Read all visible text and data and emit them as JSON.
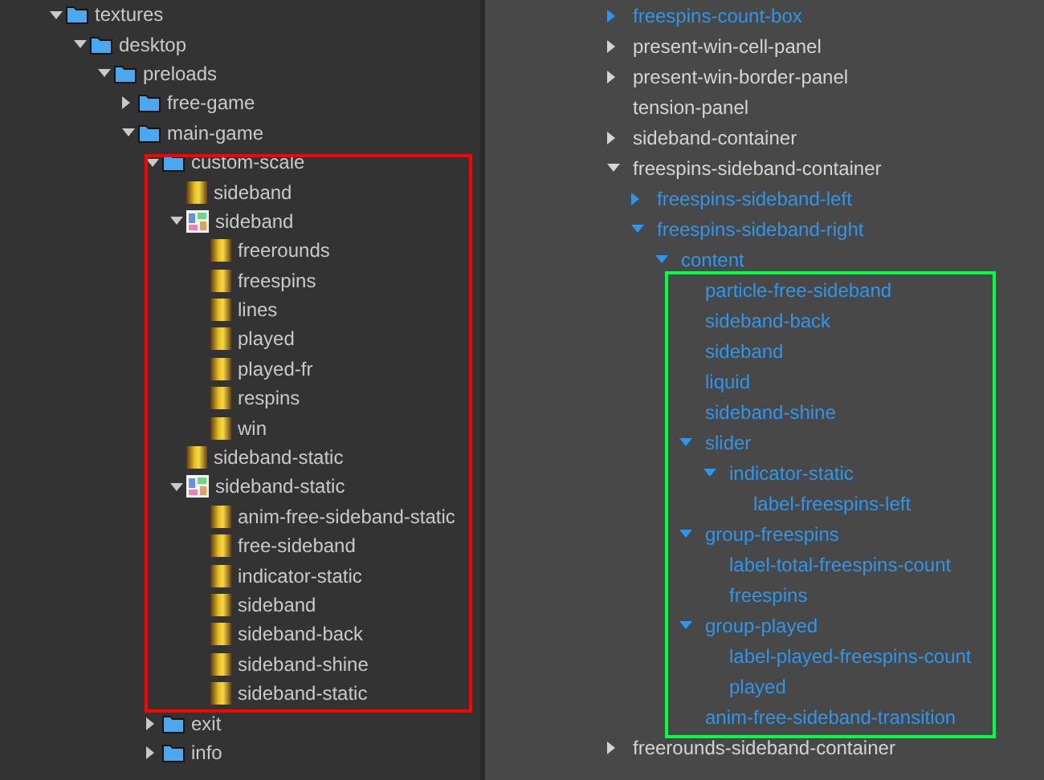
{
  "assets": {
    "nodes": [
      {
        "label": "textures",
        "kind": "folder",
        "expanded": true,
        "children": [
          {
            "label": "desktop",
            "kind": "folder",
            "expanded": true,
            "children": [
              {
                "label": "preloads",
                "kind": "folder",
                "expanded": true,
                "children": [
                  {
                    "label": "free-game",
                    "kind": "folder",
                    "expanded": false
                  },
                  {
                    "label": "main-game",
                    "kind": "folder",
                    "expanded": true,
                    "children": [
                      {
                        "label": "custom-scale",
                        "kind": "folder",
                        "expanded": true,
                        "outlined": true,
                        "children": [
                          {
                            "label": "sideband",
                            "kind": "image"
                          },
                          {
                            "label": "sideband",
                            "kind": "atlas",
                            "expanded": true,
                            "children": [
                              {
                                "label": "freerounds",
                                "kind": "image"
                              },
                              {
                                "label": "freespins",
                                "kind": "image"
                              },
                              {
                                "label": "lines",
                                "kind": "image"
                              },
                              {
                                "label": "played",
                                "kind": "image"
                              },
                              {
                                "label": "played-fr",
                                "kind": "image"
                              },
                              {
                                "label": "respins",
                                "kind": "image"
                              },
                              {
                                "label": "win",
                                "kind": "image"
                              }
                            ]
                          },
                          {
                            "label": "sideband-static",
                            "kind": "image"
                          },
                          {
                            "label": "sideband-static",
                            "kind": "atlas",
                            "expanded": true,
                            "children": [
                              {
                                "label": "anim-free-sideband-static",
                                "kind": "image"
                              },
                              {
                                "label": "free-sideband",
                                "kind": "image"
                              },
                              {
                                "label": "indicator-static",
                                "kind": "image"
                              },
                              {
                                "label": "sideband",
                                "kind": "image"
                              },
                              {
                                "label": "sideband-back",
                                "kind": "image"
                              },
                              {
                                "label": "sideband-shine",
                                "kind": "image"
                              },
                              {
                                "label": "sideband-static",
                                "kind": "image"
                              }
                            ]
                          }
                        ]
                      },
                      {
                        "label": "exit",
                        "kind": "folder",
                        "expanded": false
                      },
                      {
                        "label": "info",
                        "kind": "folder",
                        "expanded": false
                      }
                    ]
                  }
                ]
              }
            ]
          }
        ]
      }
    ]
  },
  "hierarchy": {
    "nodes": [
      {
        "label": "freespins-count-box",
        "highlighted": true,
        "expanded": false
      },
      {
        "label": "present-win-cell-panel",
        "highlighted": false,
        "expanded": false
      },
      {
        "label": "present-win-border-panel",
        "highlighted": false,
        "expanded": false
      },
      {
        "label": "tension-panel",
        "highlighted": false
      },
      {
        "label": "sideband-container",
        "highlighted": false,
        "expanded": false
      },
      {
        "label": "freespins-sideband-container",
        "highlighted": false,
        "expanded": true,
        "children": [
          {
            "label": "freespins-sideband-left",
            "highlighted": true,
            "expanded": false
          },
          {
            "label": "freespins-sideband-right",
            "highlighted": true,
            "expanded": true,
            "children": [
              {
                "label": "content",
                "highlighted": true,
                "expanded": true,
                "children_outlined": true,
                "children": [
                  {
                    "label": "particle-free-sideband",
                    "highlighted": true
                  },
                  {
                    "label": "sideband-back",
                    "highlighted": true
                  },
                  {
                    "label": "sideband",
                    "highlighted": true
                  },
                  {
                    "label": "liquid",
                    "highlighted": true
                  },
                  {
                    "label": "sideband-shine",
                    "highlighted": true
                  },
                  {
                    "label": "slider",
                    "highlighted": true,
                    "expanded": true,
                    "children": [
                      {
                        "label": "indicator-static",
                        "highlighted": true,
                        "expanded": true,
                        "children": [
                          {
                            "label": "label-freespins-left",
                            "highlighted": true
                          }
                        ]
                      }
                    ]
                  },
                  {
                    "label": "group-freespins",
                    "highlighted": true,
                    "expanded": true,
                    "children": [
                      {
                        "label": "label-total-freespins-count",
                        "highlighted": true
                      },
                      {
                        "label": "freespins",
                        "highlighted": true
                      }
                    ]
                  },
                  {
                    "label": "group-played",
                    "highlighted": true,
                    "expanded": true,
                    "children": [
                      {
                        "label": "label-played-freespins-count",
                        "highlighted": true
                      },
                      {
                        "label": "played",
                        "highlighted": true
                      }
                    ]
                  },
                  {
                    "label": "anim-free-sideband-transition",
                    "highlighted": true
                  }
                ]
              }
            ]
          }
        ]
      },
      {
        "label": "freerounds-sideband-container",
        "highlighted": false,
        "expanded": false
      }
    ]
  }
}
